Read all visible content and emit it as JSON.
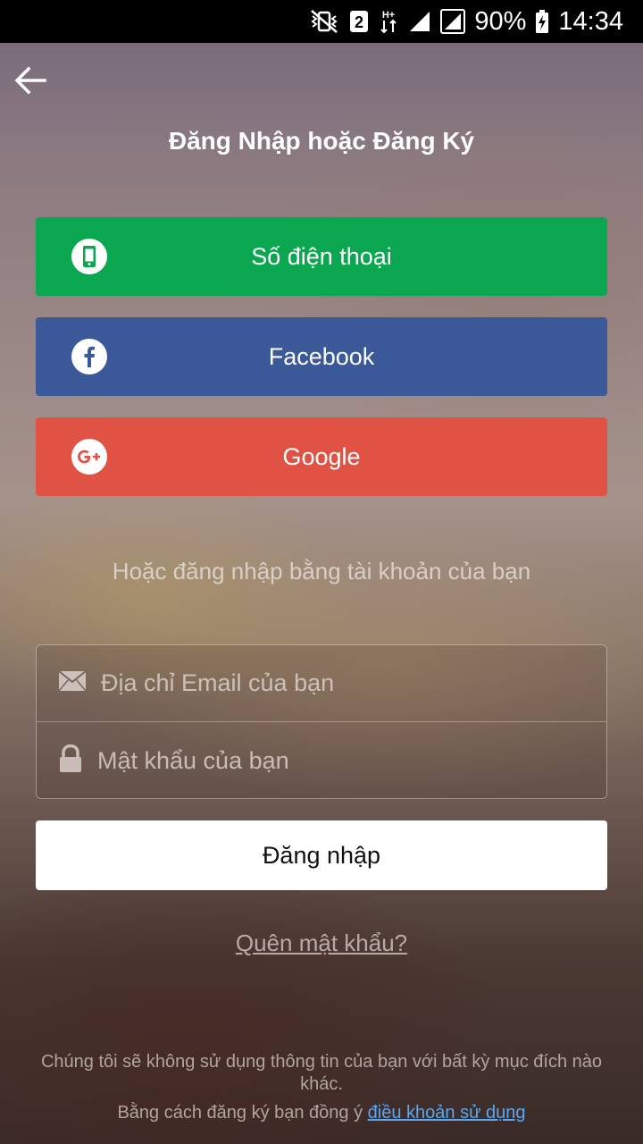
{
  "status_bar": {
    "sim": "2",
    "network": "H+",
    "battery": "90%",
    "time": "14:34"
  },
  "header": {
    "title": "Đăng Nhập hoặc Đăng Ký"
  },
  "social": {
    "phone_label": "Số điện thoại",
    "facebook_label": "Facebook",
    "google_label": "Google"
  },
  "divider_text": "Hoặc đăng nhập bằng tài khoản của bạn",
  "form": {
    "email_placeholder": "Địa chỉ Email của bạn",
    "email_value": "",
    "password_placeholder": "Mật khẩu của bạn",
    "password_value": ""
  },
  "login_label": "Đăng nhập",
  "forgot_label": "Quên mật khẩu?",
  "footer": {
    "notice": "Chúng tôi sẽ không sử dụng thông tin của bạn với bất kỳ mục đích nào khác.",
    "agree_prefix": "Bằng cách đăng ký bạn đồng ý ",
    "terms_link": "điều khoản sử dụng"
  },
  "colors": {
    "phone": "#0ba650",
    "facebook": "#3b5998",
    "google": "#e05243",
    "link": "#5aa7f0"
  },
  "icons": [
    "mute-vibrate-icon",
    "sim-2-icon",
    "network-h-plus-icon",
    "signal-icon",
    "signal-sim2-icon",
    "battery-charging-icon",
    "back-arrow-icon",
    "phone-icon",
    "facebook-icon",
    "google-plus-icon",
    "envelope-icon",
    "lock-icon"
  ]
}
